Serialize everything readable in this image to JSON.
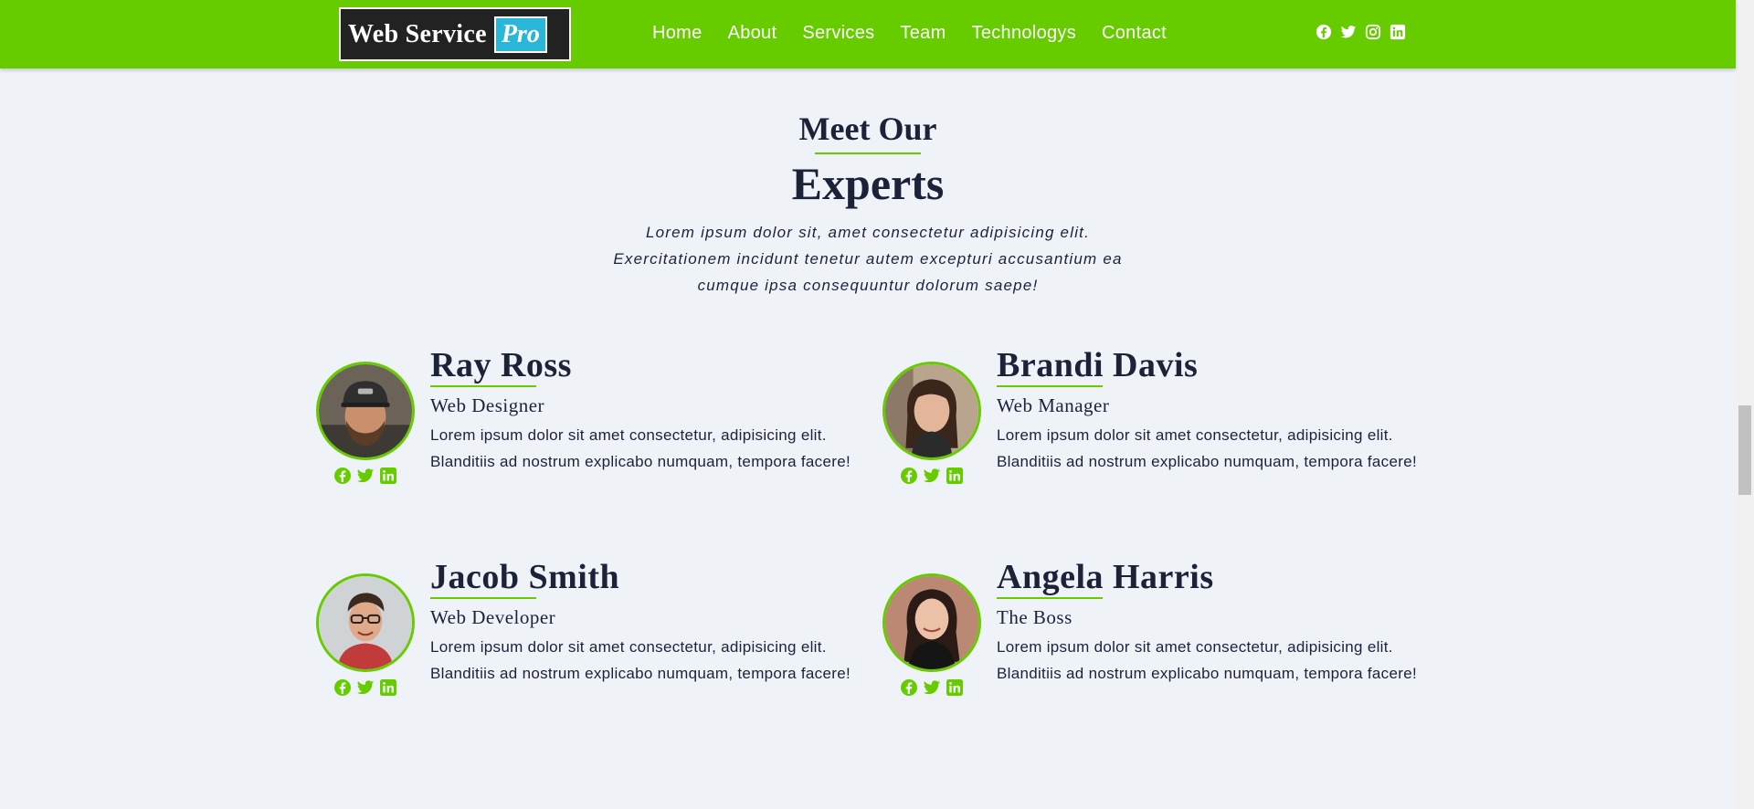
{
  "brand": {
    "name": "Web Service",
    "badge": "Pro"
  },
  "nav": {
    "links": [
      "Home",
      "About",
      "Services",
      "Team",
      "Technologys",
      "Contact"
    ],
    "social_icons": [
      "facebook-icon",
      "twitter-icon",
      "instagram-icon",
      "linkedin-icon"
    ]
  },
  "section": {
    "title_line1": "Meet Our",
    "title_line2": "Experts",
    "description": "Lorem ipsum dolor sit, amet consectetur adipisicing elit. Exercitationem incidunt tenetur autem excepturi accusantium ea cumque ipsa consequuntur dolorum saepe!"
  },
  "team": [
    {
      "name": "Ray Ross",
      "role": "Web Designer",
      "bio": "Lorem ipsum dolor sit amet consectetur, adipisicing elit. Blanditiis ad nostrum explicabo numquam, tempora facere!",
      "social_icons": [
        "facebook-icon",
        "twitter-icon",
        "linkedin-icon"
      ]
    },
    {
      "name": "Brandi Davis",
      "role": "Web Manager",
      "bio": "Lorem ipsum dolor sit amet consectetur, adipisicing elit. Blanditiis ad nostrum explicabo numquam, tempora facere!",
      "social_icons": [
        "facebook-icon",
        "twitter-icon",
        "linkedin-icon"
      ]
    },
    {
      "name": "Jacob Smith",
      "role": "Web Developer",
      "bio": "Lorem ipsum dolor sit amet consectetur, adipisicing elit. Blanditiis ad nostrum explicabo numquam, tempora facere!",
      "social_icons": [
        "facebook-icon",
        "twitter-icon",
        "linkedin-icon"
      ]
    },
    {
      "name": "Angela Harris",
      "role": "The Boss",
      "bio": "Lorem ipsum dolor sit amet consectetur, adipisicing elit. Blanditiis ad nostrum explicabo numquam, tempora facere!",
      "social_icons": [
        "facebook-icon",
        "twitter-icon",
        "linkedin-icon"
      ]
    }
  ],
  "colors": {
    "accent": "#66cc00",
    "badge": "#29b6d8",
    "brand_bg": "#222222",
    "page_bg": "#eff3f8",
    "text": "#1c2238"
  }
}
